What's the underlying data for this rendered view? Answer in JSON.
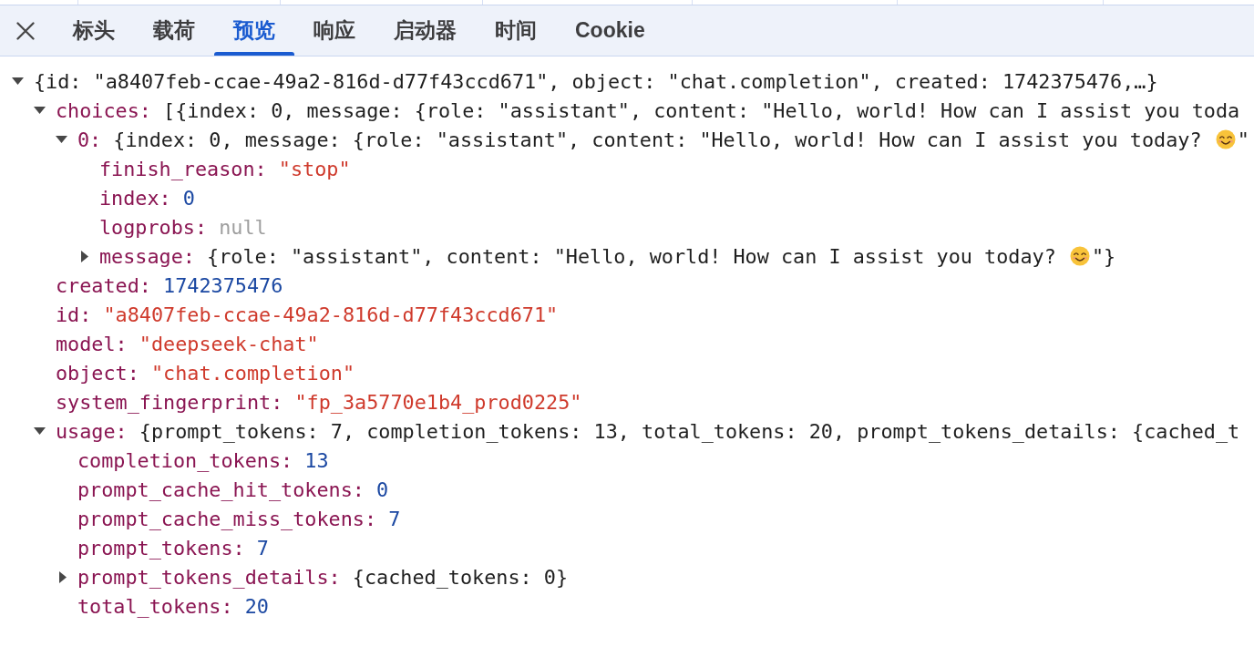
{
  "tabs": [
    {
      "label": "标头",
      "selected": false
    },
    {
      "label": "载荷",
      "selected": false
    },
    {
      "label": "预览",
      "selected": true
    },
    {
      "label": "响应",
      "selected": false
    },
    {
      "label": "启动器",
      "selected": false
    },
    {
      "label": "时间",
      "selected": false
    },
    {
      "label": "Cookie",
      "selected": false
    }
  ],
  "tree": [
    {
      "kind": "object",
      "expanded": true,
      "preview_segments": [
        "{id: \"a8407feb-ccae-49a2-816d-d77f43ccd671\", object: \"chat.completion\", created: 1742375476,…}"
      ],
      "children": [
        {
          "key": "choices:",
          "kind": "object",
          "expanded": true,
          "preview_segments": [
            "[{index: 0, message: {role: \"assistant\", content: \"Hello, world! How can I assist you toda"
          ],
          "children": [
            {
              "key": "0:",
              "kind": "object",
              "expanded": true,
              "preview_segments": [
                "{index: 0, message: {role: \"assistant\", content: \"Hello, world! How can I assist you today? ",
                "\""
              ],
              "children": [
                {
                  "key": "finish_reason:",
                  "kind": "string",
                  "value": "\"stop\""
                },
                {
                  "key": "index:",
                  "kind": "number",
                  "value": "0"
                },
                {
                  "key": "logprobs:",
                  "kind": "null",
                  "value": "null"
                },
                {
                  "key": "message:",
                  "kind": "object",
                  "expanded": false,
                  "preview_segments": [
                    "{role: \"assistant\", content: \"Hello, world! How can I assist you today? ",
                    "\"}"
                  ]
                }
              ]
            }
          ]
        },
        {
          "key": "created:",
          "kind": "number",
          "value": "1742375476"
        },
        {
          "key": "id:",
          "kind": "string",
          "value": "\"a8407feb-ccae-49a2-816d-d77f43ccd671\""
        },
        {
          "key": "model:",
          "kind": "string",
          "value": "\"deepseek-chat\""
        },
        {
          "key": "object:",
          "kind": "string",
          "value": "\"chat.completion\""
        },
        {
          "key": "system_fingerprint:",
          "kind": "string",
          "value": "\"fp_3a5770e1b4_prod0225\""
        },
        {
          "key": "usage:",
          "kind": "object",
          "expanded": true,
          "preview_segments": [
            "{prompt_tokens: 7, completion_tokens: 13, total_tokens: 20, prompt_tokens_details: {cached_t"
          ],
          "children": [
            {
              "key": "completion_tokens:",
              "kind": "number",
              "value": "13"
            },
            {
              "key": "prompt_cache_hit_tokens:",
              "kind": "number",
              "value": "0"
            },
            {
              "key": "prompt_cache_miss_tokens:",
              "kind": "number",
              "value": "7"
            },
            {
              "key": "prompt_tokens:",
              "kind": "number",
              "value": "7"
            },
            {
              "key": "prompt_tokens_details:",
              "kind": "object",
              "expanded": false,
              "preview_segments": [
                "{cached_tokens: 0}"
              ]
            },
            {
              "key": "total_tokens:",
              "kind": "number",
              "value": "20"
            }
          ]
        }
      ]
    }
  ]
}
